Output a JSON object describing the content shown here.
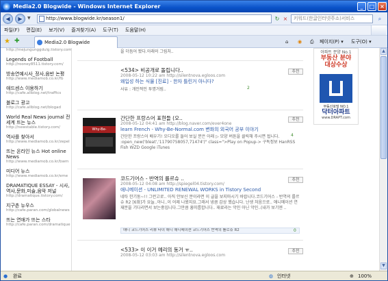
{
  "window": {
    "title": "Media2.0 Blogwide - Windows Internet Explorer"
  },
  "address": {
    "url": "http://www.blogwide.kr/season1/",
    "search_placeholder": "키워드(한글인터넷주소)서비스"
  },
  "menu": [
    "파일(F)",
    "편집(E)",
    "보기(V)",
    "즐겨찾기(A)",
    "도구(T)",
    "도움말(H)"
  ],
  "tab": {
    "label": "Media2.0 Blogwide"
  },
  "toolbar": {
    "page": "페이지(P)",
    "tools": "도구(O)"
  },
  "sidebar": [
    {
      "title": "",
      "url": "http://mejungunggdulg.tistory.com/"
    },
    {
      "title": "Legends of Football",
      "url": "http://rooney8511.tistory.com/"
    },
    {
      "title": "방송연예시사_정사,음반 논평",
      "url": "http://www.mediamob.co.kr/fb"
    },
    {
      "title": "애드센스 이용하기",
      "url": "http://cafe.allblog.net/traffics"
    },
    {
      "title": "블로그 광고",
      "url": "http://cafe.allblog.net/blogad"
    },
    {
      "title": "World Real News journal 전 세계 뜨는 뉴스",
      "url": "http://newstable.tistory.com/"
    },
    {
      "title": "역사를 찾아서",
      "url": "http://www.mediamob.co.kr/zepel"
    },
    {
      "title": "뜨는 온라인 뉴스 Hot online News",
      "url": "http://www.mediamob.co.kr/bwm"
    },
    {
      "title": "미디어 뉴스",
      "url": "http://www.mediamob.co.kr/eme"
    },
    {
      "title": "DRAMATIQUE ESSAY - 시사,역사,문화,미술,음악 저널",
      "url": "http://dramatique.tistory.com/"
    },
    {
      "title": "지구촌 뉴우스",
      "url": "http://cafe.paran.com/globalnews"
    },
    {
      "title": "뜨는 연애가 뜨는 스타",
      "url": "http://cafe.paran.com/dramatique"
    }
  ],
  "posts": [
    {
      "title": "을 더듬어 봤다.아래의 그림처..",
      "meta": "",
      "sub": "",
      "desc": ""
    },
    {
      "title": "<534> 비공개로 돌립니다..",
      "meta": "2008-05-12 10:22 am   http://silentnova.egloos.com",
      "sub": "왜입성 하는 식물 [진료] - 한자 틀린거 아니다?",
      "desc": "사유 : 개인적인 투명거림..",
      "rec": "추천",
      "count": "2"
    },
    {
      "title": "간단한 프랑스어 표현들 (오..",
      "meta": "2008-05-12 04:41 am   http://blog.naver.com/ever4one",
      "sub": "learn French  -  Why-Be-Normal.com 변화의 외국어 공부 이야기",
      "desc": "간단한 프랑스어 배우기! 오디오를 들어 보실 분은 아래 ▷ 모양 버튼을 클릭해 주시면 됩니다. :open_new('bleat','11790758057,71474')\" class=\">Play on Popup-> 구독정보 HanRSS Fish WZD Google iTunes",
      "rec": "추천",
      "count": "4",
      "thumb_text": "Why-Be-Normal.com"
    },
    {
      "title": "코드기어스 - 반역의 를르슈 ..",
      "meta": "2008-05-12 04:08 am   http://spiegel04.tistory.com/",
      "sub": "애니메이션  -  UNLIMITED RENEWAL WORKS in Tistory Second",
      "desc": "네타 한기둥~!! 그런고로.. 아직 안보신 분이라면 이 글을 보지마시기 바랍니다.코드기어스 - 반역의 를르슈 R2 [6화]가 요늘..아니..이 어제 나왔지요.그래서 냉큼 감상 했습니다. 난생 처음으로.. 애니메이션 연재분을 기다리면서 보는중입니다.그만큼 흥미롭합니다.. 재료라는 악인 아닌 악인..(내가 보기엔 ..",
      "rec": "추천",
      "count": "0",
      "tag_text": "애니 코드기어스 리뷰 타이 애니 애니메이션 코드기어스 반역의 를르슈 R2"
    },
    {
      "title": "<533> 이 이거 예리의 동거 ㅠ..",
      "meta": "2008-05-12 03:03 am   http://silentnova.egloos.com",
      "sub": "",
      "desc": "",
      "rec": "추천"
    }
  ],
  "ad": {
    "line1": "아파트 분양 No.1",
    "line2": "부동산 분야",
    "line3": "대상수상",
    "line4": "부동산포털 NO.1",
    "line5": "닥터아파트",
    "line6": "www.DRAPT.com"
  },
  "status": {
    "left": "완료",
    "zone": "인터넷",
    "zoom": "100%"
  }
}
